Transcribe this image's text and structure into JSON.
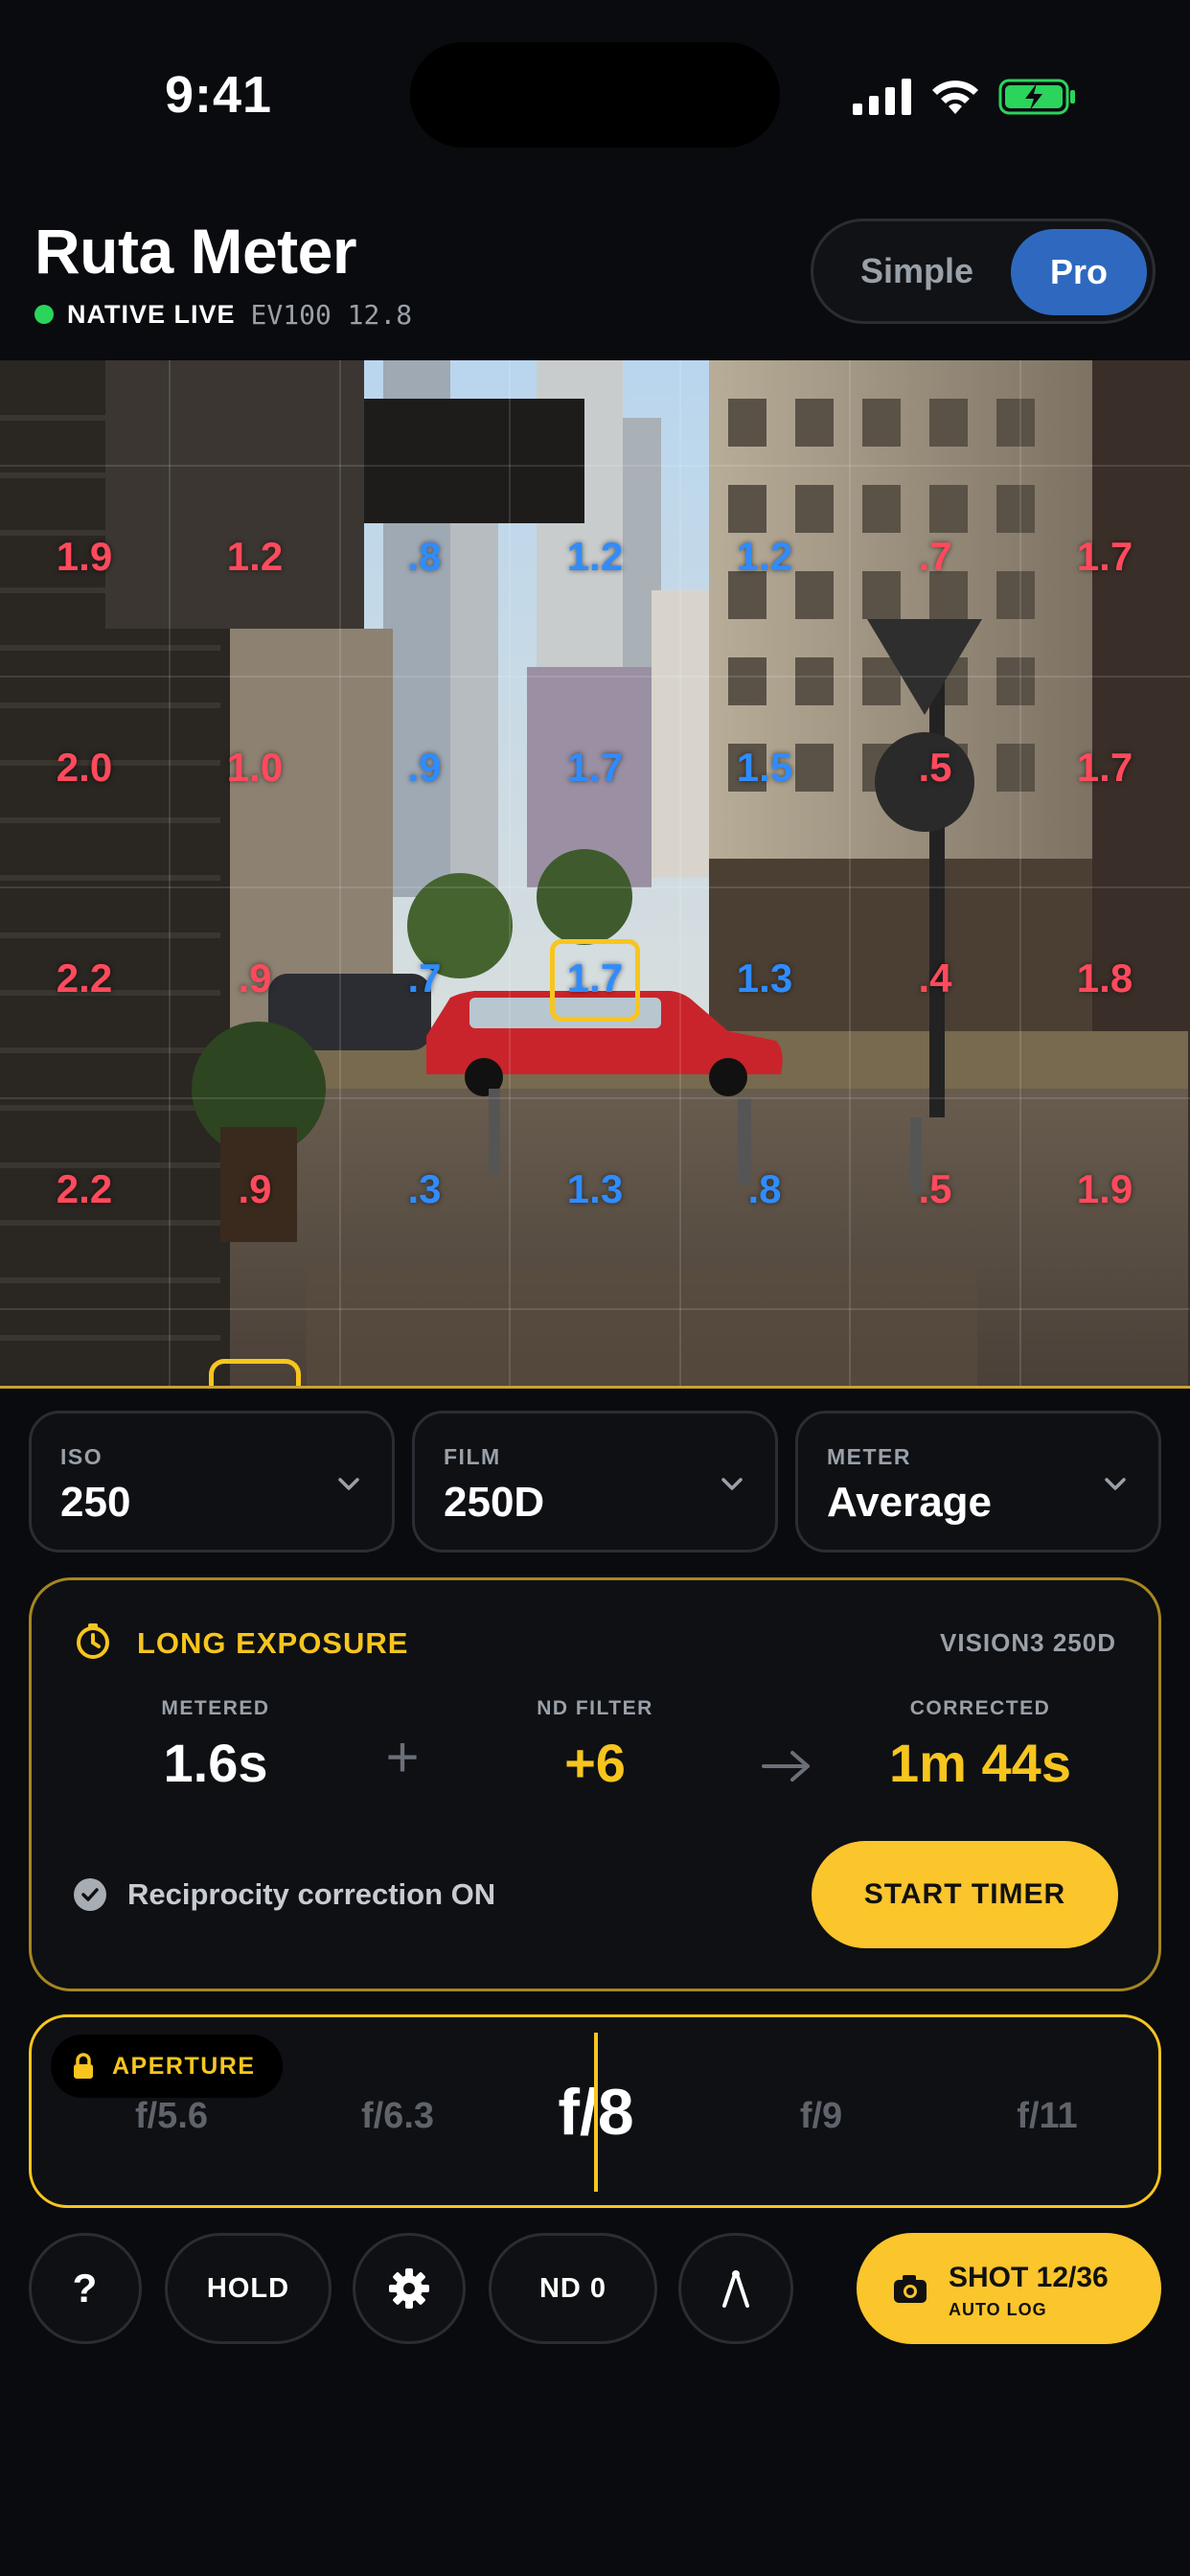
{
  "status_bar": {
    "time": "9:41"
  },
  "header": {
    "title": "Ruta Meter",
    "live_label": "NATIVE LIVE",
    "ev_readout": "EV100 12.8",
    "mode_toggle": {
      "options": [
        "Simple",
        "Pro"
      ],
      "selected": "Pro"
    }
  },
  "viewfinder": {
    "ev_grid": [
      [
        "1.9",
        "1.2",
        ".8",
        "1.2",
        "1.2",
        ".7",
        "1.7"
      ],
      [
        "2.0",
        "1.0",
        ".9",
        "1.7",
        "1.5",
        ".5",
        "1.7"
      ],
      [
        "2.2",
        ".9",
        ".7",
        "1.7",
        "1.3",
        ".4",
        "1.8"
      ],
      [
        "2.2",
        ".9",
        ".3",
        "1.3",
        ".8",
        ".5",
        "1.9"
      ]
    ],
    "ev_grid_colors": [
      [
        "red",
        "red",
        "blue",
        "blue",
        "blue",
        "red",
        "red"
      ],
      [
        "red",
        "red",
        "blue",
        "blue",
        "blue",
        "red",
        "red"
      ],
      [
        "red",
        "red",
        "blue",
        "blue",
        "blue",
        "red",
        "red"
      ],
      [
        "red",
        "red",
        "blue",
        "blue",
        "blue",
        "red",
        "red"
      ]
    ],
    "spot_cell": "1.7"
  },
  "selectors": {
    "iso": {
      "label": "ISO",
      "value": "250"
    },
    "film": {
      "label": "FILM",
      "value": "250D"
    },
    "meter": {
      "label": "METER",
      "value": "Average"
    }
  },
  "long_exposure": {
    "title": "LONG EXPOSURE",
    "film_name": "VISION3 250D",
    "metered_label": "METERED",
    "metered_value": "1.6s",
    "nd_label": "ND FILTER",
    "nd_value": "+6",
    "corrected_label": "CORRECTED",
    "corrected_value": "1m 44s",
    "reciprocity_text": "Reciprocity correction ON",
    "timer_button": "START TIMER"
  },
  "aperture": {
    "badge": "APERTURE",
    "stops": [
      "f/5.6",
      "f/6.3",
      "f/8",
      "f/9",
      "f/11"
    ],
    "selected": "f/8"
  },
  "toolbar": {
    "help": "?",
    "hold": "HOLD",
    "nd": "ND 0",
    "shot_main": "SHOT 12/36",
    "shot_sub": "AUTO LOG"
  },
  "colors": {
    "accent": "#f7c51e",
    "pro_blue": "#2f69bf",
    "ev_over": "#ff4a5c",
    "ev_under": "#2f8cff",
    "live": "#2bd45b"
  }
}
